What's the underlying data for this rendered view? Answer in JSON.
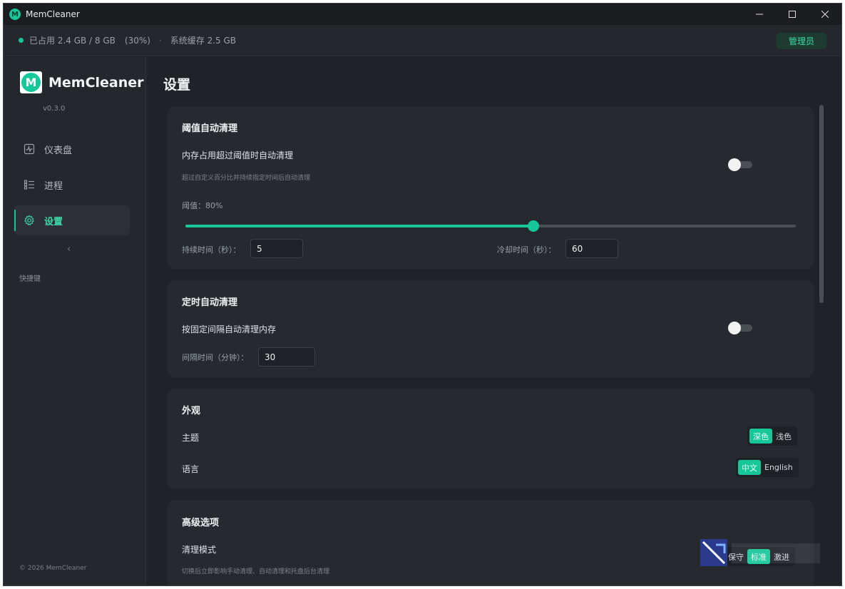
{
  "window": {
    "title": "MemCleaner",
    "icon_letter": "M",
    "controls": {
      "minimize": "─",
      "maximize": "☐",
      "close": "✕"
    }
  },
  "status": {
    "used": "已占用 2.4 GB / 8 GB",
    "percent": "(30%)",
    "separator": "·",
    "cache": "系统缓存 2.5 GB",
    "role": "管理员"
  },
  "sidebar": {
    "brand": "MemCleaner",
    "logo_letter": "M",
    "version": "v0.3.0",
    "items": [
      {
        "label": "仪表盘",
        "icon": "activity-icon",
        "active": false
      },
      {
        "label": "进程",
        "icon": "list-icon",
        "active": false
      },
      {
        "label": "设置",
        "icon": "gear-icon",
        "active": true
      }
    ],
    "collapse": "‹",
    "shortcut": "快捷键",
    "copyright": "© 2026 MemCleaner"
  },
  "main": {
    "title": "设置",
    "threshold": {
      "title": "阈值自动清理",
      "toggle_label": "内存占用超过阈值时自动清理",
      "toggle_desc": "超过自定义百分比并持续指定时间后自动清理",
      "enabled": false,
      "threshold_label": "阈值：80%",
      "threshold_fraction": 0.57,
      "duration_label": "持续时间（秒）：",
      "duration_value": "5",
      "cooldown_label": "冷却时间（秒）：",
      "cooldown_value": "60"
    },
    "scheduled": {
      "title": "定时自动清理",
      "toggle_label": "按固定间隔自动清理内存",
      "enabled": false,
      "interval_label": "间隔时间（分钟）：",
      "interval_value": "30"
    },
    "appearance": {
      "title": "外观",
      "theme_label": "主题",
      "theme_options": [
        "深色",
        "浅色"
      ],
      "theme_selected": "深色",
      "language_label": "语言",
      "language_options": [
        "中文",
        "English"
      ],
      "language_selected": "中文"
    },
    "advanced": {
      "title": "高级选项",
      "mode_label": "清理模式",
      "mode_desc": "切换后立即影响手动清理、自动清理和托盘后台清理",
      "mode_options": [
        "保守",
        "标准",
        "激进"
      ]
    }
  },
  "colors": {
    "accent": "#16c79a",
    "background": "#1f2227",
    "card": "#262a2f"
  }
}
